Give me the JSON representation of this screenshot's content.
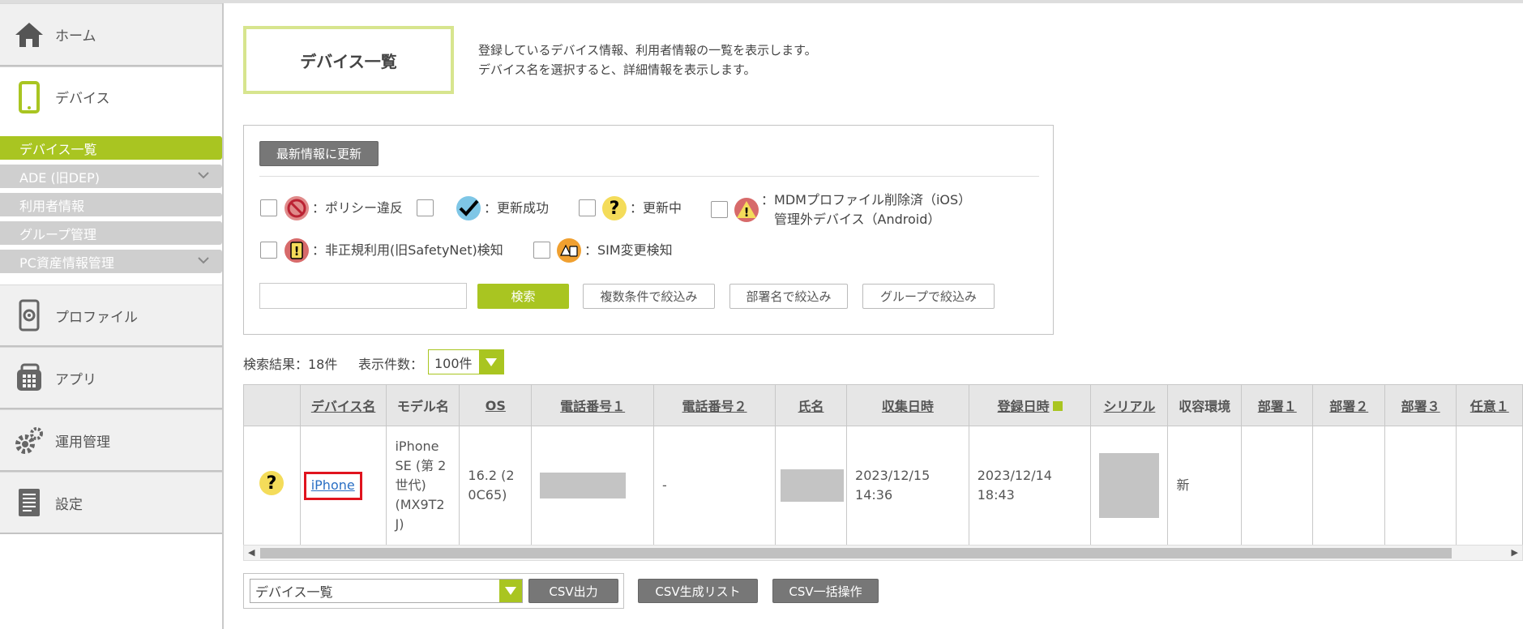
{
  "sidebar": {
    "home": "ホーム",
    "device": "デバイス",
    "sub_items": [
      {
        "label": "デバイス一覧"
      },
      {
        "label": "ADE (旧DEP)"
      },
      {
        "label": "利用者情報"
      },
      {
        "label": "グループ管理"
      },
      {
        "label": "PC資産情報管理"
      }
    ],
    "profile": "プロファイル",
    "app": "アプリ",
    "ops": "運用管理",
    "settings": "設定"
  },
  "header": {
    "title": "デバイス一覧",
    "desc1": "登録しているデバイス情報、利用者情報の一覧を表示します。",
    "desc2": "デバイス名を選択すると、詳細情報を表示します。"
  },
  "filter": {
    "refresh_label": "最新情報に更新",
    "legend": {
      "policy": "：ポリシー違反",
      "success": "：更新成功",
      "updating": "：更新中",
      "mdm1": "MDMプロファイル削除済（iOS）",
      "mdm2": "管理外デバイス（Android）",
      "safetynet": "：非正規利用(旧SafetyNet)検知",
      "sim": "：SIM変更検知"
    },
    "search_value": "",
    "search_label": "検索",
    "multi_label": "複数条件で絞込み",
    "dept_label": "部署名で絞込み",
    "group_label": "グループで絞込み"
  },
  "results": {
    "count_text": "検索結果：18件",
    "per_page_label": "表示件数：",
    "per_page_value": "100件"
  },
  "table": {
    "headers": [
      "デバイス名",
      "モデル名",
      "OS",
      "電話番号１",
      "電話番号２",
      "氏名",
      "収集日時",
      "登録日時",
      "シリアル",
      "収容環境",
      "部署１",
      "部署２",
      "部署３",
      "任意１"
    ],
    "row": {
      "device_name": "iPhone",
      "model": "iPhone SE (第 2 世代) (MX9T2 J)",
      "os": "16.2 (2 0C65)",
      "phone2": "-",
      "collected": "2023/12/15 14:36",
      "registered": "2023/12/14 18:43",
      "env": "新"
    }
  },
  "bottom": {
    "select_value": "デバイス一覧",
    "csv_out": "CSV出力",
    "csv_list": "CSV生成リスト",
    "csv_bulk": "CSV一括操作"
  },
  "colors": {
    "accent": "#a9c521",
    "highlight": "#e0141e"
  }
}
